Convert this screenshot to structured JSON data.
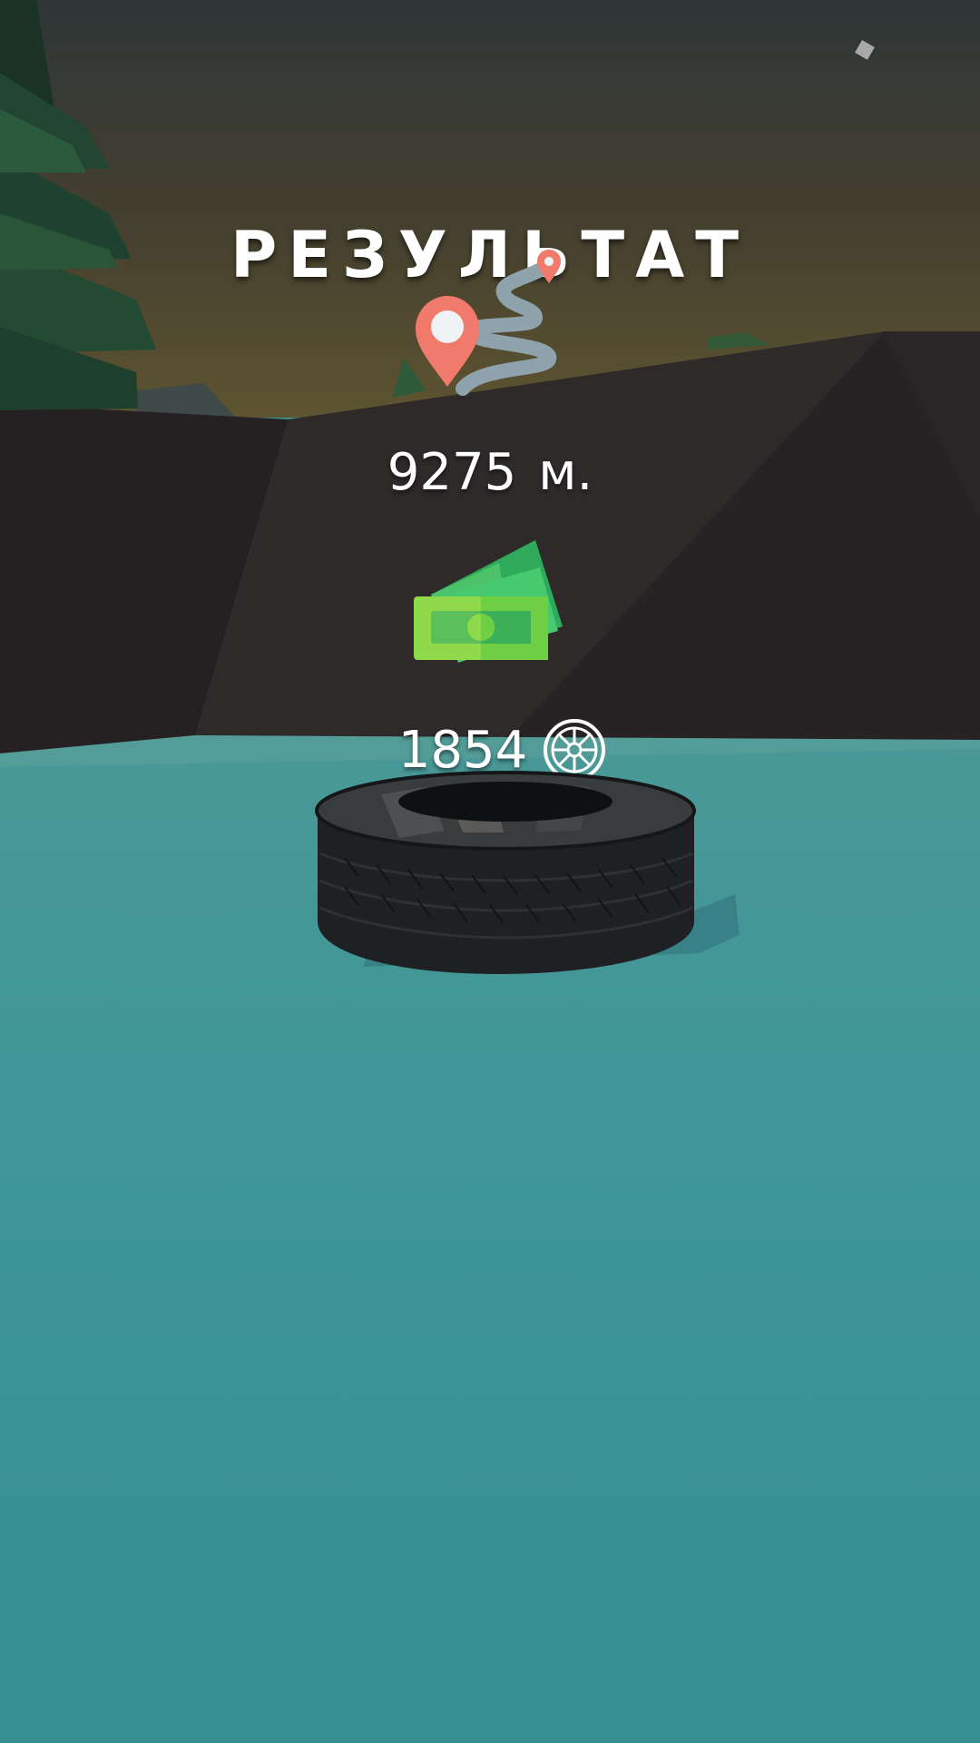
{
  "results": {
    "title": "РЕЗУЛЬТАТ",
    "distance_value": "9275",
    "distance_unit": "м.",
    "coins_value": "1854"
  },
  "icons": {
    "route": "route-pin-icon",
    "money": "money-cards-icon",
    "coin": "wheel-coin-icon"
  },
  "colors": {
    "ground": "#3a9494",
    "sky_top": "#2e3536",
    "sky_horizon": "#5c5232",
    "rock": "#2c2727",
    "pin": "#f07a6c",
    "money_light": "#8fd94a",
    "money_dark": "#2eaa5a"
  }
}
